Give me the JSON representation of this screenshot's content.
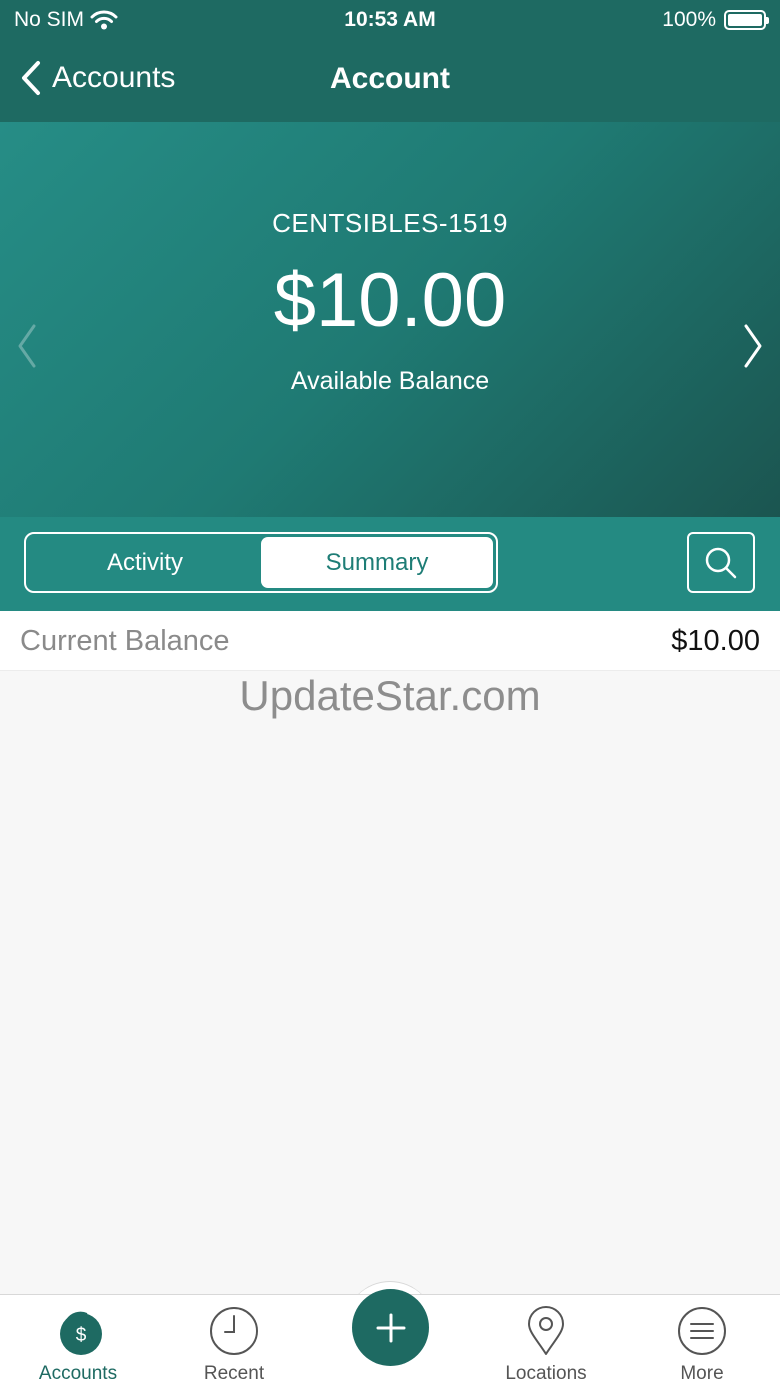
{
  "status_bar": {
    "carrier": "No SIM",
    "time": "10:53 AM",
    "battery": "100%"
  },
  "nav": {
    "back_label": "Accounts",
    "title": "Account"
  },
  "account": {
    "name": "CENTSIBLES-1519",
    "balance": "$10.00",
    "caption": "Available Balance"
  },
  "segments": {
    "activity": "Activity",
    "summary": "Summary",
    "selected": "summary"
  },
  "summary": {
    "current_balance_label": "Current Balance",
    "current_balance_value": "$10.00"
  },
  "watermark": "UpdateStar.com",
  "tabs": [
    {
      "label": "Accounts",
      "icon": "accounts-icon",
      "active": true
    },
    {
      "label": "Recent",
      "icon": "clock-icon",
      "active": false
    },
    {
      "label": "",
      "icon": "plus-icon",
      "active": false
    },
    {
      "label": "Locations",
      "icon": "location-pin-icon",
      "active": false
    },
    {
      "label": "More",
      "icon": "menu-icon",
      "active": false
    }
  ],
  "colors": {
    "primary": "#1e6a62",
    "toolbar": "#248a82",
    "hero_start": "#268d86",
    "hero_end": "#1b5550"
  }
}
